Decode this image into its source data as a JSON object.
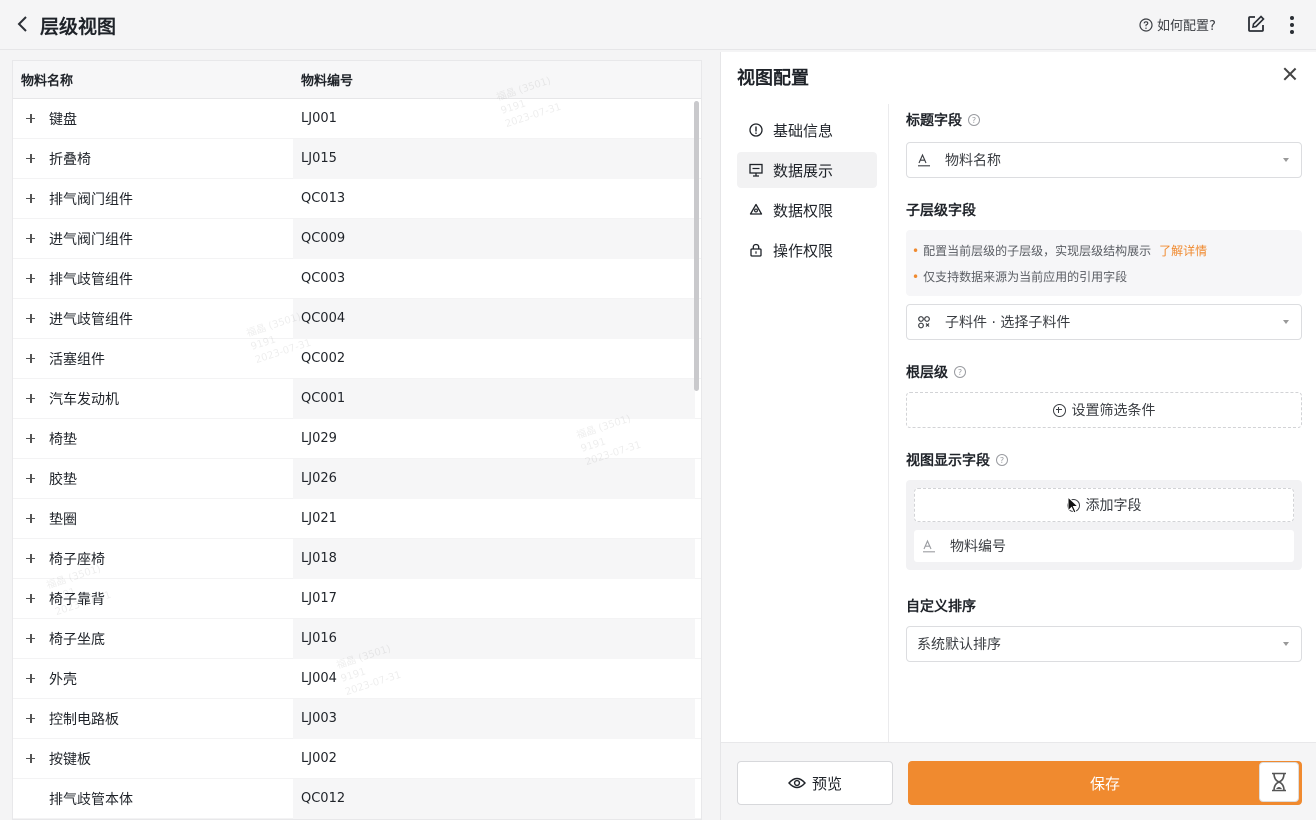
{
  "header": {
    "title": "层级视图",
    "help_label": "如何配置?"
  },
  "table": {
    "columns": [
      "物料名称",
      "物料编号"
    ],
    "rows": [
      {
        "name": "键盘",
        "code": "LJ001",
        "expandable": true
      },
      {
        "name": "折叠椅",
        "code": "LJ015",
        "expandable": true
      },
      {
        "name": "排气阀门组件",
        "code": "QC013",
        "expandable": true
      },
      {
        "name": "进气阀门组件",
        "code": "QC009",
        "expandable": true
      },
      {
        "name": "排气歧管组件",
        "code": "QC003",
        "expandable": true
      },
      {
        "name": "进气歧管组件",
        "code": "QC004",
        "expandable": true
      },
      {
        "name": "活塞组件",
        "code": "QC002",
        "expandable": true
      },
      {
        "name": "汽车发动机",
        "code": "QC001",
        "expandable": true
      },
      {
        "name": "椅垫",
        "code": "LJ029",
        "expandable": true
      },
      {
        "name": "胶垫",
        "code": "LJ026",
        "expandable": true
      },
      {
        "name": "垫圈",
        "code": "LJ021",
        "expandable": true
      },
      {
        "name": "椅子座椅",
        "code": "LJ018",
        "expandable": true
      },
      {
        "name": "椅子靠背",
        "code": "LJ017",
        "expandable": true
      },
      {
        "name": "椅子坐底",
        "code": "LJ016",
        "expandable": true
      },
      {
        "name": "外壳",
        "code": "LJ004",
        "expandable": true
      },
      {
        "name": "控制电路板",
        "code": "LJ003",
        "expandable": true
      },
      {
        "name": "按键板",
        "code": "LJ002",
        "expandable": true
      },
      {
        "name": "排气歧管本体",
        "code": "QC012",
        "expandable": false
      }
    ]
  },
  "panel": {
    "title": "视图配置",
    "nav": [
      {
        "label": "基础信息",
        "icon": "info-circle-icon",
        "active": false
      },
      {
        "label": "数据展示",
        "icon": "monitor-icon",
        "active": true
      },
      {
        "label": "数据权限",
        "icon": "recycle-icon",
        "active": false
      },
      {
        "label": "操作权限",
        "icon": "lock-icon",
        "active": false
      }
    ],
    "title_field": {
      "label": "标题字段",
      "value": "物料名称",
      "icon": "text-field-icon"
    },
    "child_field": {
      "label": "子层级字段",
      "hint1": "配置当前层级的子层级，实现层级结构展示",
      "hint_link": "了解详情",
      "hint2": "仅支持数据来源为当前应用的引用字段",
      "value": "子料件 · 选择子料件",
      "icon": "relation-icon"
    },
    "root_level": {
      "label": "根层级",
      "button": "设置筛选条件"
    },
    "display_fields": {
      "label": "视图显示字段",
      "add_button": "添加字段",
      "items": [
        "物料编号"
      ]
    },
    "sort": {
      "label": "自定义排序",
      "value": "系统默认排序"
    },
    "footer": {
      "preview": "预览",
      "save": "保存"
    }
  },
  "colors": {
    "accent": "#f08a2f"
  }
}
